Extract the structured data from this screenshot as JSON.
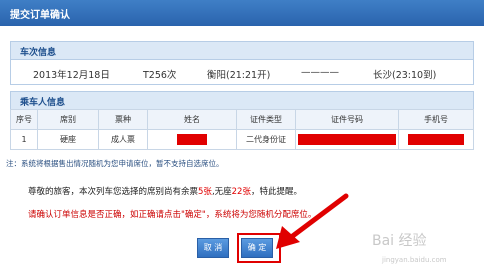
{
  "dialog": {
    "title": "提交订单确认"
  },
  "train_section": {
    "header": "车次信息",
    "date": "2013年12月18日",
    "train_no": "T256次",
    "from": "衡阳(21:21开)",
    "dash": "————",
    "to": "长沙(23:10到)"
  },
  "passenger_section": {
    "header": "乘车人信息",
    "columns": [
      "序号",
      "席别",
      "票种",
      "姓名",
      "证件类型",
      "证件号码",
      "手机号"
    ],
    "row": {
      "index": "1",
      "seat": "硬座",
      "ticket_type": "成人票",
      "id_type": "二代身份证"
    }
  },
  "note": "注：系统将根据售出情况随机为您申请席位，暂不支持自选席位。",
  "message": {
    "prefix": "尊敬的旅客，本次列车您选择的席别尚有余票",
    "remaining": "5张",
    "mid": ",无座",
    "no_seat": "22张",
    "suffix": "，特此提醒。"
  },
  "confirm_hint": "请确认订单信息是否正确，如正确请点击\"确定\"，系统将为您随机分配席位。",
  "buttons": {
    "cancel": "取 消",
    "confirm": "确 定"
  },
  "watermark": {
    "logo": "Bai 经验",
    "url": "jingyan.baidu.com"
  },
  "colors": {
    "accent": "#2a63ad",
    "highlight": "#e00000"
  }
}
